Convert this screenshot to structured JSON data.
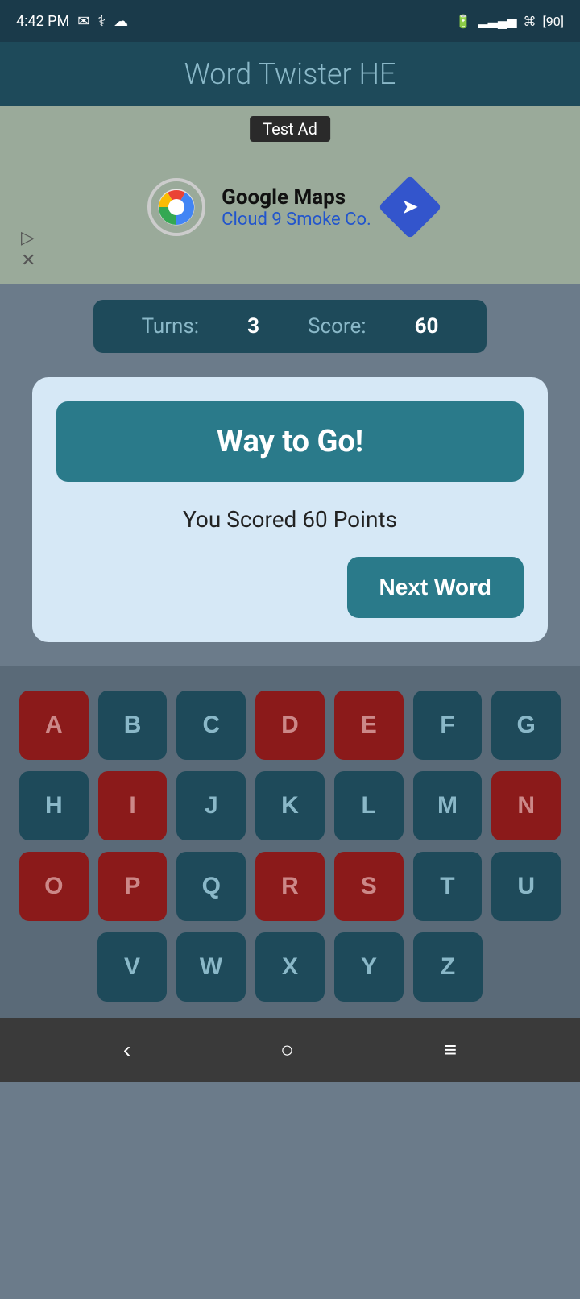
{
  "statusBar": {
    "time": "4:42 PM",
    "battery": "90"
  },
  "appHeader": {
    "title": "Word Twister HE"
  },
  "ad": {
    "label": "Test Ad",
    "company": "Google Maps",
    "subtitle": "Cloud 9 Smoke Co."
  },
  "scoreBar": {
    "turnsLabel": "Turns:",
    "turnsValue": "3",
    "scoreLabel": "Score:",
    "scoreValue": "60"
  },
  "dialog": {
    "headerText": "Way to Go!",
    "scoreText": "You Scored 60 Points",
    "nextWordLabel": "Next Word"
  },
  "keyboard": {
    "rows": [
      [
        "A",
        "B",
        "C",
        "D",
        "E",
        "F",
        "G"
      ],
      [
        "H",
        "I",
        "J",
        "K",
        "L",
        "M",
        "N"
      ],
      [
        "O",
        "P",
        "Q",
        "R",
        "S",
        "T",
        "U"
      ],
      [
        "V",
        "W",
        "X",
        "Y",
        "Z"
      ]
    ],
    "highlighted": [
      "D",
      "E",
      "I",
      "N",
      "O",
      "P",
      "R",
      "S"
    ]
  },
  "navBar": {
    "back": "‹",
    "home": "○",
    "menu": "≡"
  }
}
